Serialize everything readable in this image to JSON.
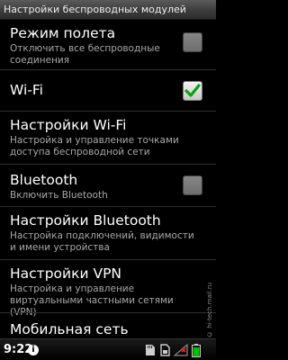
{
  "title_bar": {
    "title": "Настройки беспроводных модулей"
  },
  "items": [
    {
      "title": "Режим полета",
      "summary": "Отключить все беспроводные соединения",
      "checkbox": "unchecked-disabled"
    },
    {
      "title": "Wi-Fi",
      "summary": "",
      "checkbox": "checked"
    },
    {
      "title": "Настройки Wi-Fi",
      "summary": "Настройка и управление точками доступа беспроводной сети",
      "checkbox": "none"
    },
    {
      "title": "Bluetooth",
      "summary": "Включить Bluetooth",
      "checkbox": "unchecked-disabled"
    },
    {
      "title": "Настройки Bluetooth",
      "summary": "Настройка подключений, видимости и имени устройства",
      "checkbox": "none"
    },
    {
      "title": "Настройки VPN",
      "summary": "Настройка и управление виртуальными частными сетями (VPN)",
      "checkbox": "none"
    },
    {
      "title": "Мобильная сеть",
      "summary": "",
      "checkbox": "none"
    }
  ],
  "status_bar": {
    "time": "9:22",
    "battery_color": "#00c000"
  },
  "watermark": "© hi-tech.mail.ru",
  "colors": {
    "check_green": "#0aa30a"
  }
}
